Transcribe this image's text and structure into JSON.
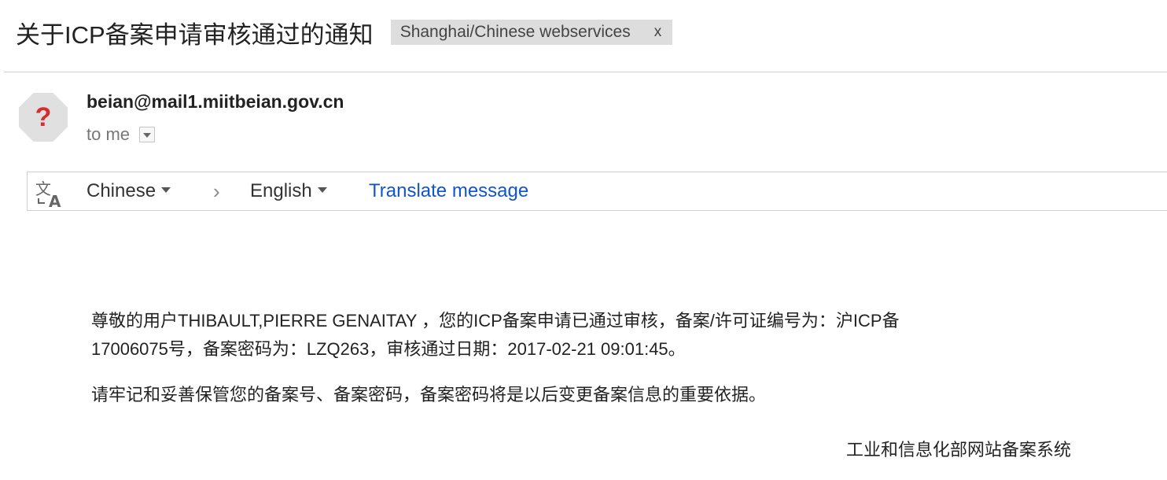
{
  "email": {
    "subject": "关于ICP备案申请审核通过的通知",
    "label": "Shanghai/Chinese webservices",
    "label_remove": "x",
    "avatar_glyph": "?",
    "sender": "beian@mail1.miitbeian.gov.cn",
    "recipient": "to me"
  },
  "translate": {
    "icon": "translate-icon",
    "source_lang": "Chinese",
    "arrow": "›",
    "target_lang": "English",
    "action": "Translate message"
  },
  "body": {
    "p1_line1": "尊敬的用户THIBAULT,PIERRE GENAITAY ，您的ICP备案申请已通过审核，备案/许可证编号为：沪ICP备",
    "p1_line2": "17006075号，备案密码为：LZQ263，审核通过日期：2017-02-21 09:01:45。",
    "p2": "请牢记和妥善保管您的备案号、备案密码，备案密码将是以后变更备案信息的重要依据。",
    "signature": "工业和信息化部网站备案系统"
  },
  "colors": {
    "link": "#1155cc",
    "label_bg": "#dddddd",
    "avatar_mark": "#d32f2f"
  }
}
